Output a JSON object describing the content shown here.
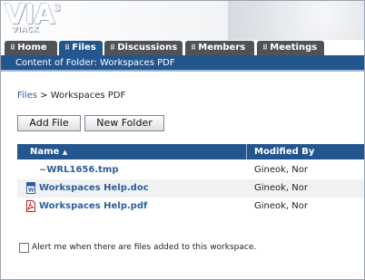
{
  "brand": {
    "name": "VIA",
    "superscript": "3",
    "subtitle": "VIACK"
  },
  "tabs": [
    {
      "label": "Home",
      "active": false
    },
    {
      "label": "Files",
      "active": true
    },
    {
      "label": "Discussions",
      "active": false
    },
    {
      "label": "Members",
      "active": false
    },
    {
      "label": "Meetings",
      "active": false
    }
  ],
  "subbar": "Content of Folder: Workspaces PDF",
  "breadcrumb": {
    "root": "Files",
    "sep": ">",
    "current": "Workspaces PDF"
  },
  "buttons": {
    "add_file": "Add File",
    "new_folder": "New Folder"
  },
  "table": {
    "col_name": "Name",
    "sort_indicator": "▲",
    "col_modified": "Modified By",
    "rows": [
      {
        "icon": "temp-file-icon",
        "name": "~WRL1656.tmp",
        "modified_by": "Gineok, Nor"
      },
      {
        "icon": "word-doc-icon",
        "name": "Workspaces Help.doc",
        "modified_by": "Gineok, Nor"
      },
      {
        "icon": "pdf-file-icon",
        "name": "Workspaces Help.pdf",
        "modified_by": "Gineok, Nor"
      }
    ]
  },
  "alert": {
    "label": "Alert me when there are files added to this workspace.",
    "checked": false
  },
  "colors": {
    "accent": "#23568f",
    "tab_inactive": "#4f5358",
    "link": "#2b5f99"
  }
}
